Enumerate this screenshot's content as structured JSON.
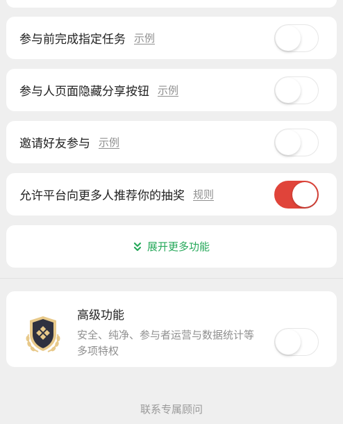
{
  "settings": [
    {
      "label": "参与前完成指定任务",
      "link": "示例",
      "enabled": false
    },
    {
      "label": "参与人页面隐藏分享按钮",
      "link": "示例",
      "enabled": false
    },
    {
      "label": "邀请好友参与",
      "link": "示例",
      "enabled": false
    },
    {
      "label": "允许平台向更多人推荐你的抽奖",
      "link": "规则",
      "enabled": true
    }
  ],
  "expand": {
    "label": "展开更多功能",
    "icon": "double-chevron-down-icon",
    "color": "#26a85a"
  },
  "premium": {
    "title": "高级功能",
    "description": "安全、纯净、参与者运营与数据统计等多项特权",
    "enabled": false,
    "icon": "premium-shield-badge-icon"
  },
  "footer": {
    "label": "联系专属顾问"
  },
  "colors": {
    "accent": "#e0443a",
    "green": "#26a85a",
    "background": "#efefef"
  }
}
